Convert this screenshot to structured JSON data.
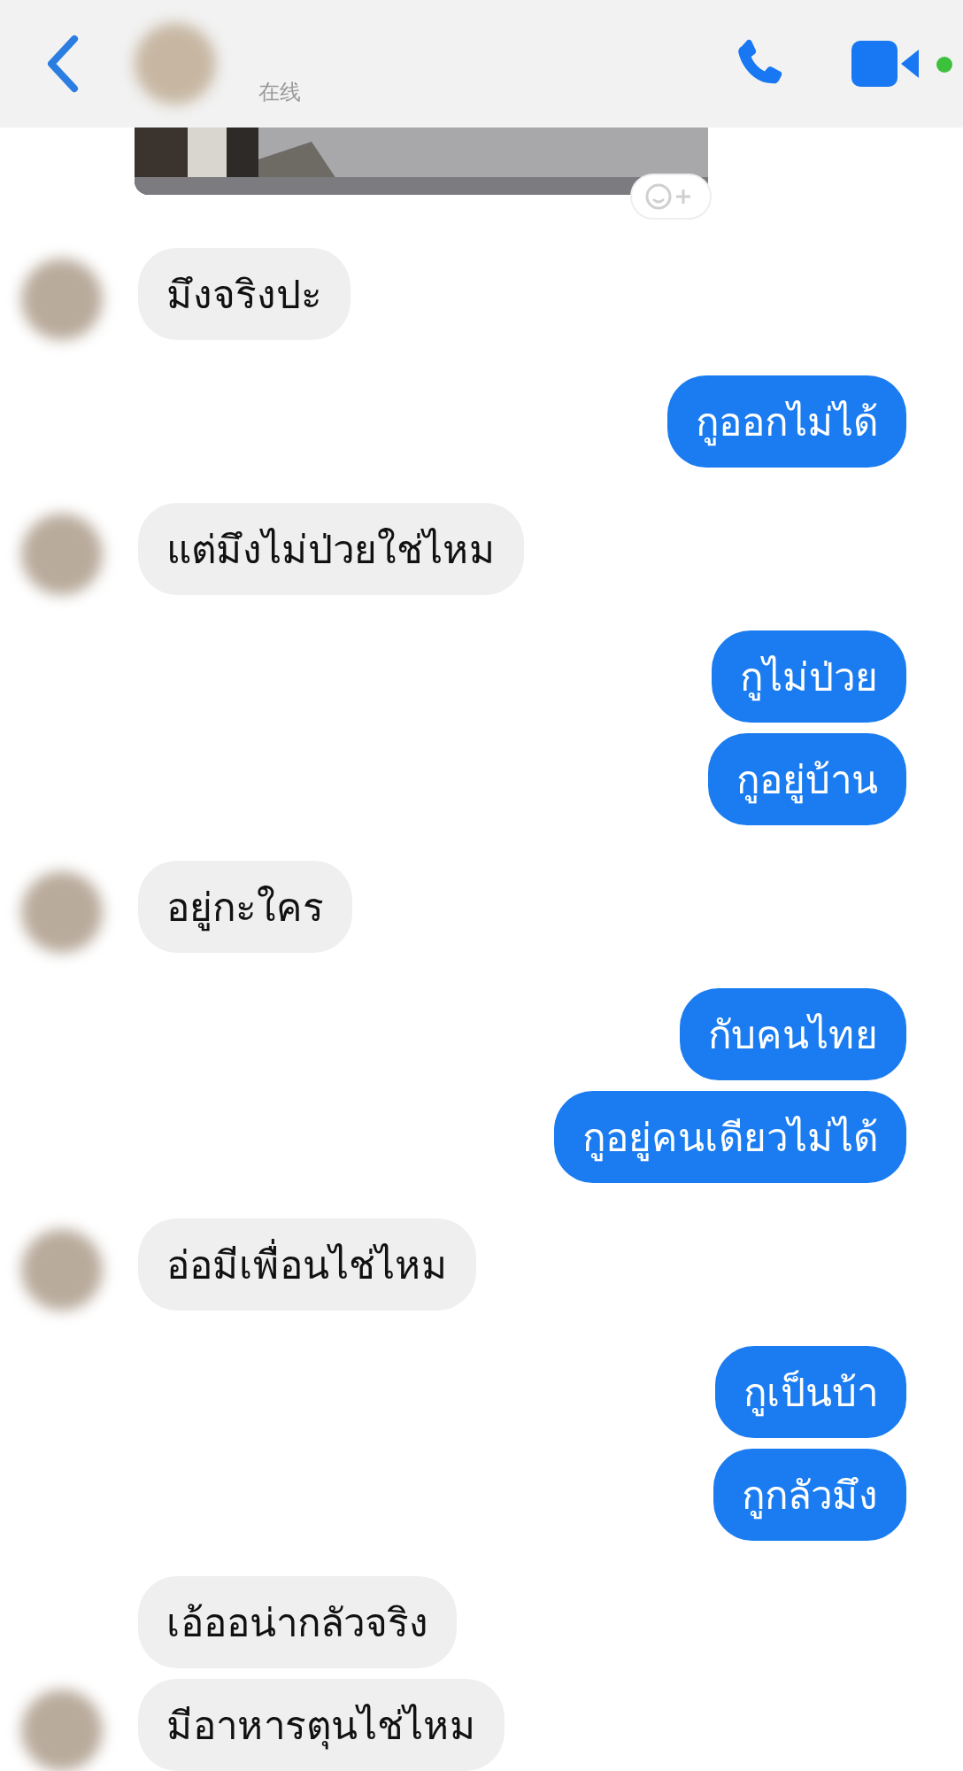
{
  "header": {
    "status": "在线"
  },
  "messages": [
    {
      "kind": "received",
      "text": "มึงจริงปะ"
    },
    {
      "kind": "sent",
      "text": "กูออกไม่ได้"
    },
    {
      "kind": "received",
      "text": "แต่มึงไม่ป่วยใช่ไหม"
    },
    {
      "kind": "sent",
      "text": "กูไม่ป่วย"
    },
    {
      "kind": "sent",
      "text": "กูอยู่บ้าน"
    },
    {
      "kind": "received",
      "text": "อยู่กะใคร"
    },
    {
      "kind": "sent",
      "text": "กับคนไทย"
    },
    {
      "kind": "sent",
      "text": "กูอยู่คนเดียวไม่ได้"
    },
    {
      "kind": "received",
      "text": "อ่อมีเพื่อนไช่ไหม"
    },
    {
      "kind": "sent",
      "text": "กูเป็นบ้า"
    },
    {
      "kind": "sent",
      "text": "กูกลัวมึง"
    },
    {
      "kind": "received",
      "text": "เอ้ออน่ากลัวจริง"
    },
    {
      "kind": "received",
      "text": "มีอาหารตุนไช่ไหม"
    }
  ]
}
